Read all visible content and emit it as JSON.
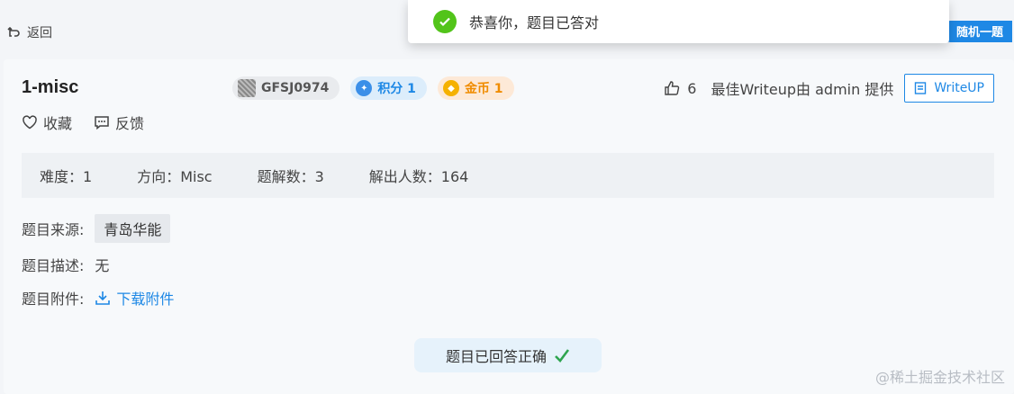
{
  "nav": {
    "back_label": "返回",
    "random_label": "随机一题"
  },
  "toast": {
    "message": "恭喜你，题目已答对"
  },
  "challenge": {
    "title": "1-misc",
    "tags": {
      "id": "GFSJ0974",
      "score": "积分 1",
      "gold": "金币 1"
    },
    "likes": "6",
    "writeup_credit": "最佳Writeup由 admin 提供",
    "writeup_button": "WriteUP",
    "favorite_label": "收藏",
    "feedback_label": "反馈",
    "stats": {
      "difficulty": "难度：1",
      "category": "方向：Misc",
      "solutions": "题解数：3",
      "solvers": "解出人数：164"
    },
    "source_label": "题目来源:",
    "source_value": "青岛华能",
    "desc_label": "题目描述:",
    "desc_value": "无",
    "attach_label": "题目附件:",
    "attach_link": "下载附件",
    "status": "题目已回答正确"
  },
  "watermark": "@稀土掘金技术社区",
  "colors": {
    "accent": "#1e88e5",
    "success": "#52c41a",
    "gold": "#f08c00"
  }
}
